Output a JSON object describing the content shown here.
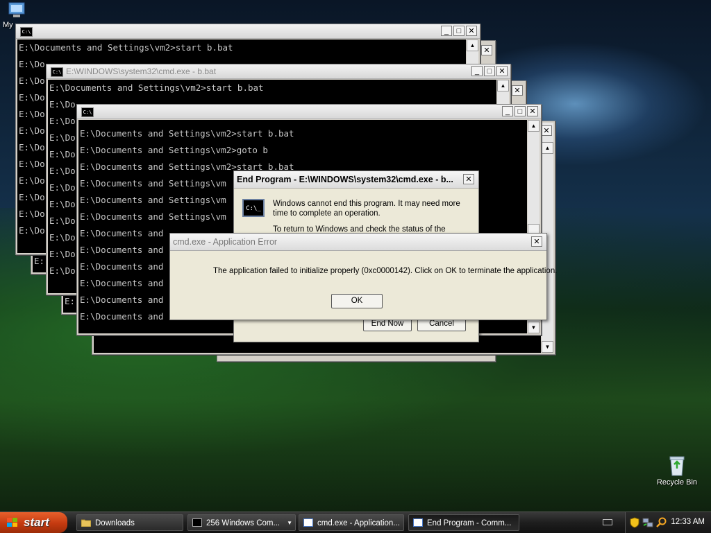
{
  "desktop": {
    "icons": [
      {
        "label": "My"
      },
      {
        "label": "Recycle Bin"
      }
    ]
  },
  "windows": {
    "w1": {
      "title": "",
      "lines": [
        "E:\\Documents and Settings\\vm2>start b.bat",
        "E:\\Do",
        "E:\\Do",
        "E:\\Do",
        "E:\\Do",
        "E:\\Do",
        "E:\\Do",
        "E:\\Do",
        "E:\\Do",
        "E:\\Do",
        "E:\\Do",
        "E:\\Do"
      ]
    },
    "w2": {
      "title": "E:\\WINDOWS\\system32\\cmd.exe - b.bat",
      "lines": [
        "E:\\Documents and Settings\\vm2>start b.bat",
        "E:\\Do",
        "E:\\Do",
        "E:\\Do",
        "E:\\Do",
        "E:\\Do",
        "E:\\Do",
        "E:\\Do",
        "E:\\Do",
        "E:\\Do",
        "E:\\Do",
        "E:\\Do"
      ]
    },
    "w3": {
      "title": "",
      "lines": [
        "E:\\Documents and Settings\\vm2>start b.bat",
        "E:\\Documents and Settings\\vm2>goto b",
        "E:\\Documents and Settings\\vm2>start b.bat",
        "E:\\Documents and Settings\\vm",
        "E:\\Documents and Settings\\vm",
        "E:\\Documents and Settings\\vm",
        "E:\\Documents and",
        "E:\\Documents and",
        "E:\\Documents and",
        "E:\\Documents and",
        "E:\\Documents and",
        "E:\\Documents and"
      ]
    },
    "tail": {
      "w_back_line": "E:"
    }
  },
  "end_program": {
    "title": "End Program - E:\\WINDOWS\\system32\\cmd.exe - b...",
    "message_1": "Windows cannot end this program. It may need more time to complete an operation.",
    "message_2": "To return to Windows and check the status of the",
    "end_now": "End Now",
    "cancel": "Cancel"
  },
  "app_error": {
    "title": "cmd.exe - Application Error",
    "message": "The application failed to initialize properly (0xc0000142). Click on OK to terminate the application.",
    "ok": "OK"
  },
  "taskbar": {
    "start": "start",
    "items": [
      {
        "label": "Downloads"
      },
      {
        "label": "256 Windows Com..."
      },
      {
        "label": "cmd.exe - Application..."
      },
      {
        "label": "End Program - Comm..."
      }
    ],
    "clock": "12:33 AM"
  }
}
